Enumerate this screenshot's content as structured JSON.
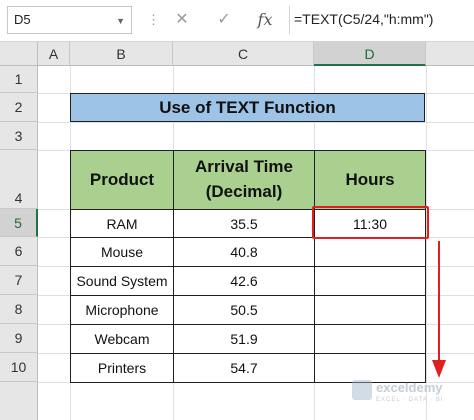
{
  "formula_bar": {
    "name_box": "D5",
    "cancel_icon": "✕",
    "confirm_icon": "✓",
    "fx_label": "fx",
    "formula": "=TEXT(C5/24,\"h:mm\")"
  },
  "columns": [
    "A",
    "B",
    "C",
    "D"
  ],
  "selected_column": "D",
  "rows": [
    "1",
    "2",
    "3",
    "4",
    "5",
    "6",
    "7",
    "8",
    "9",
    "10"
  ],
  "selected_row": "5",
  "sheet": {
    "title": "Use of TEXT Function",
    "headers": {
      "product": "Product",
      "arrival_line1": "Arrival Time",
      "arrival_line2": "(Decimal)",
      "hours": "Hours"
    },
    "data": [
      {
        "product": "RAM",
        "arrival": "35.5",
        "hours": "11:30"
      },
      {
        "product": "Mouse",
        "arrival": "40.8",
        "hours": ""
      },
      {
        "product": "Sound System",
        "arrival": "42.6",
        "hours": ""
      },
      {
        "product": "Microphone",
        "arrival": "50.5",
        "hours": ""
      },
      {
        "product": "Webcam",
        "arrival": "51.9",
        "hours": ""
      },
      {
        "product": "Printers",
        "arrival": "54.7",
        "hours": ""
      }
    ]
  },
  "annotation_color": "#e0201f",
  "watermark": {
    "name": "exceldemy",
    "tagline": "EXCEL · DATA · BI"
  }
}
